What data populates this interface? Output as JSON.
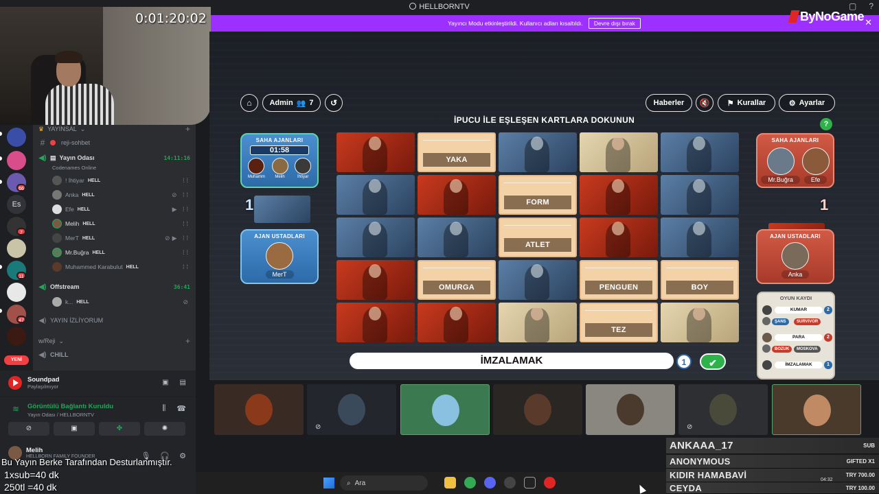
{
  "window": {
    "title": "HELLBORNTV",
    "stream_timer": "0:01:20:02",
    "brand": "ByNoGame"
  },
  "streamer_banner": {
    "text": "Yayıncı Modu etkinleştirildi. Kullanıcı adları kısaltıldı.",
    "button": "Devre dışı bırak"
  },
  "rail": {
    "badges": [
      "66",
      "7",
      "11",
      "47"
    ],
    "es_label": "Es",
    "new_label": "YENİ"
  },
  "channels": {
    "category": "YAYINSAL",
    "text_channel": "reji-sohbet",
    "voice_channel": "Yayın Odası",
    "voice_time": "14:11:16",
    "voice_activity": "Codenames Online",
    "voice_users": [
      {
        "name": "! İhtiyar",
        "tag": "HELL"
      },
      {
        "name": "Anka",
        "tag": "HELL"
      },
      {
        "name": "Efe",
        "tag": "HELL"
      },
      {
        "name": "Melih",
        "tag": "HELL"
      },
      {
        "name": "MerT",
        "tag": "HELL"
      },
      {
        "name": "Mr.Buğra",
        "tag": "HELL"
      },
      {
        "name": "Muhammed Karabulut",
        "tag": "HELL"
      }
    ],
    "offstream": {
      "name": "Offstream",
      "time": "36:41",
      "user": "k...",
      "tag": "HELL"
    },
    "watching": "YAYIN İZLİYORUM",
    "category2": "w/Reji",
    "chill": "CHILL"
  },
  "soundpad": {
    "title": "Soundpad",
    "sub": "Paylaşılmıyor"
  },
  "connection": {
    "title": "Görüntülü Bağlantı Kuruldu",
    "sub": "Yayın Odası / HELLBORNTV"
  },
  "user": {
    "name": "Melih",
    "status": "HELLBORN FAMILY FOUNDER"
  },
  "overlay": {
    "line1": "Bu Yayın Berke Tarafından Desturlanmıştır.",
    "line2": "1xsub=40 dk",
    "line3": "250tl =40 dk"
  },
  "game": {
    "instruction": "İPUCU İLE EŞLEŞEN KARTLARA DOKUNUN",
    "admin_label": "Admin",
    "player_count": "7",
    "news": "Haberler",
    "rules": "Kurallar",
    "settings": "Ayarlar",
    "help": "?",
    "blue_agents": {
      "title": "SAHA AJANLARI",
      "timer": "01:58",
      "players": [
        "Muhamm",
        "Melih",
        "İhtiyar"
      ]
    },
    "blue_score": "1",
    "blue_master": {
      "title": "AJAN USTADLARI",
      "player": "MerT"
    },
    "red_agents": {
      "title": "SAHA AJANLARI",
      "players": [
        "Mr.Buğra",
        "Efe"
      ]
    },
    "red_score": "1",
    "red_master": {
      "title": "AJAN USTADLARI",
      "player": "Anka"
    },
    "cards": [
      {
        "type": "red",
        "word": ""
      },
      {
        "type": "word",
        "word": "YAKA"
      },
      {
        "type": "blue",
        "word": ""
      },
      {
        "type": "neutral",
        "word": ""
      },
      {
        "type": "blue",
        "word": ""
      },
      {
        "type": "blue",
        "word": ""
      },
      {
        "type": "red",
        "word": ""
      },
      {
        "type": "word",
        "word": "FORM"
      },
      {
        "type": "red",
        "word": ""
      },
      {
        "type": "blue",
        "word": ""
      },
      {
        "type": "blue",
        "word": ""
      },
      {
        "type": "blue",
        "word": ""
      },
      {
        "type": "word",
        "word": "ATLET"
      },
      {
        "type": "red",
        "word": ""
      },
      {
        "type": "blue",
        "word": ""
      },
      {
        "type": "red",
        "word": ""
      },
      {
        "type": "word",
        "word": "OMURGA"
      },
      {
        "type": "blue",
        "word": ""
      },
      {
        "type": "word",
        "word": "PENGUEN"
      },
      {
        "type": "word",
        "word": "BOY"
      },
      {
        "type": "red",
        "word": ""
      },
      {
        "type": "red",
        "word": ""
      },
      {
        "type": "neutral",
        "word": ""
      },
      {
        "type": "word",
        "word": "TEZ"
      },
      {
        "type": "neutral",
        "word": ""
      }
    ],
    "clue": "İMZALAMAK",
    "clue_number": "1",
    "log": {
      "title": "OYUN KAYDI",
      "entries": [
        {
          "player": "MerT",
          "word": "KUMAR",
          "num": "2",
          "color": "#2d6aa8"
        },
        {
          "tags": [
            "ŞANS",
            "SURVIVOR"
          ]
        },
        {
          "player": "Anka",
          "word": "PARA",
          "num": "2",
          "color": "#c83a2a"
        },
        {
          "tags": [
            "BOZUK",
            "MOSKOVA"
          ]
        },
        {
          "player": "MerT",
          "word": "İMZALAMAK",
          "num": "1",
          "color": "#2d6aa8"
        }
      ]
    }
  },
  "subs": {
    "header_name": "ANKAAA_17",
    "header_value": "SUB",
    "rows": [
      {
        "name": "ANONYMOUS",
        "value": "GIFTED X1"
      },
      {
        "name": "KIDIR HAMABAVİ",
        "value": "TRY 700.00"
      },
      {
        "name": "CEYDA",
        "value": "TRY 100.00"
      }
    ]
  },
  "taskbar": {
    "search": "Ara"
  },
  "tray": {
    "time": "04:32"
  }
}
